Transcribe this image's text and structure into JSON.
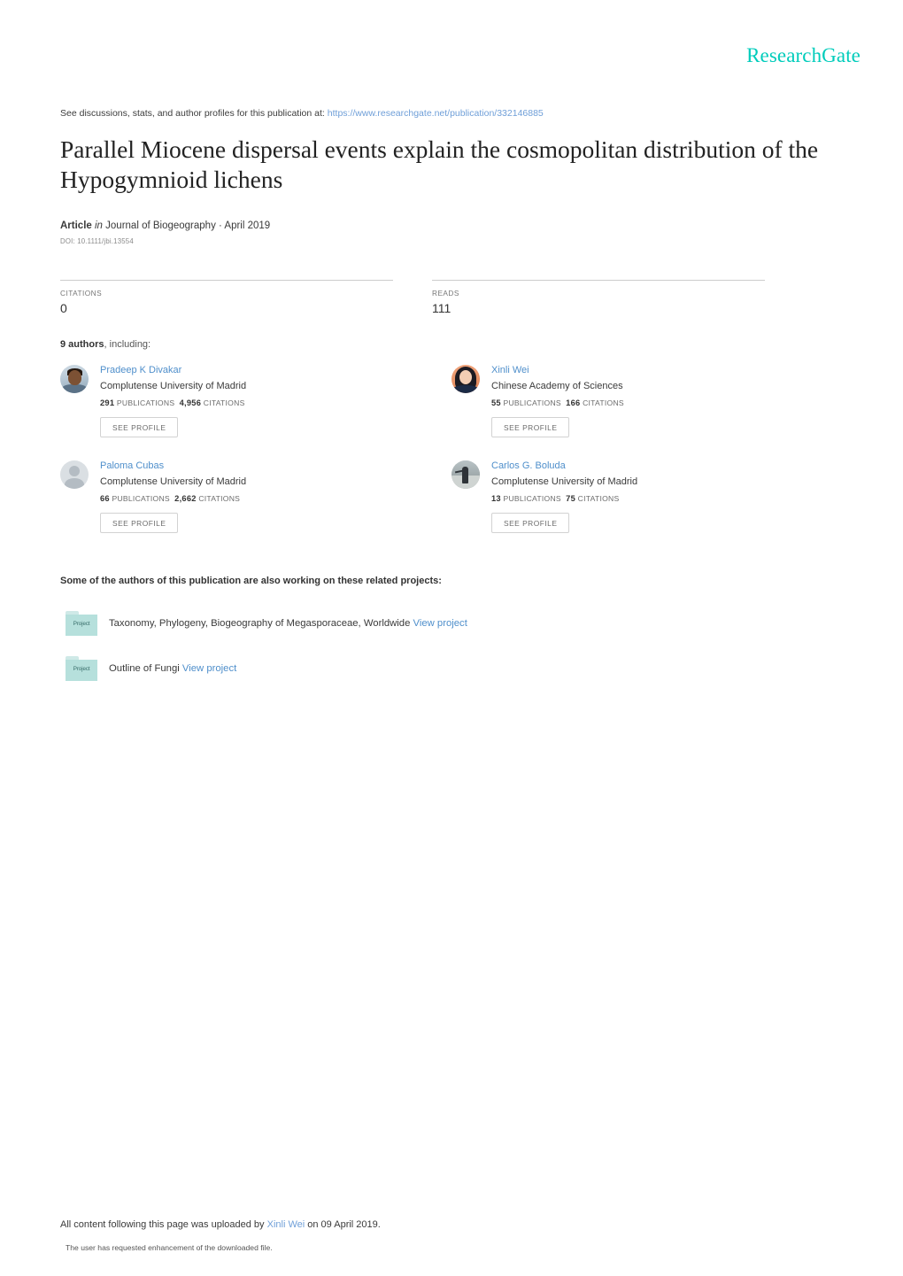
{
  "brand": {
    "name": "ResearchGate",
    "accent_color": "#00ccbb",
    "link_color": "#4f8fcb"
  },
  "discussion_notice": {
    "prefix": "See discussions, stats, and author profiles for this publication at:",
    "url": "https://www.researchgate.net/publication/332146885"
  },
  "publication": {
    "title": "Parallel Miocene dispersal events explain the cosmopolitan distribution of the Hypogymnioid lichens",
    "type_label": "Article",
    "in_label": "in",
    "venue": "Journal of Biogeography · April 2019",
    "doi": "DOI: 10.1111/jbi.13554"
  },
  "stats": [
    {
      "label": "CITATIONS",
      "value": "0"
    },
    {
      "label": "READS",
      "value": "111"
    }
  ],
  "authors_header": {
    "count_label": "9 authors",
    "suffix": ", including:"
  },
  "authors": [
    {
      "name": "Pradeep K Divakar",
      "affiliation": "Complutense University of Madrid",
      "publications": "291",
      "publications_label": "PUBLICATIONS",
      "citations": "4,956",
      "citations_label": "CITATIONS",
      "button_label": "SEE PROFILE",
      "avatar_kind": "photo-divakar"
    },
    {
      "name": "Xinli Wei",
      "affiliation": "Chinese Academy of Sciences",
      "publications": "55",
      "publications_label": "PUBLICATIONS",
      "citations": "166",
      "citations_label": "CITATIONS",
      "button_label": "SEE PROFILE",
      "avatar_kind": "photo-wei"
    },
    {
      "name": "Paloma Cubas",
      "affiliation": "Complutense University of Madrid",
      "publications": "66",
      "publications_label": "PUBLICATIONS",
      "citations": "2,662",
      "citations_label": "CITATIONS",
      "button_label": "SEE PROFILE",
      "avatar_kind": "placeholder"
    },
    {
      "name": "Carlos G. Boluda",
      "affiliation": "Complutense University of Madrid",
      "publications": "13",
      "publications_label": "PUBLICATIONS",
      "citations": "75",
      "citations_label": "CITATIONS",
      "button_label": "SEE PROFILE",
      "avatar_kind": "photo-boluda"
    }
  ],
  "projects_section": {
    "heading": "Some of the authors of this publication are also working on these related projects:",
    "icon_label": "Project",
    "items": [
      {
        "title": "Taxonomy, Phylogeny, Biogeography of Megasporaceae, Worldwide",
        "link_label": "View project"
      },
      {
        "title": "Outline of Fungi",
        "link_label": "View project"
      }
    ]
  },
  "footer": {
    "upload_prefix": "All content following this page was uploaded by",
    "uploader": "Xinli Wei",
    "upload_suffix": "on 09 April 2019.",
    "note": "The user has requested enhancement of the downloaded file."
  }
}
